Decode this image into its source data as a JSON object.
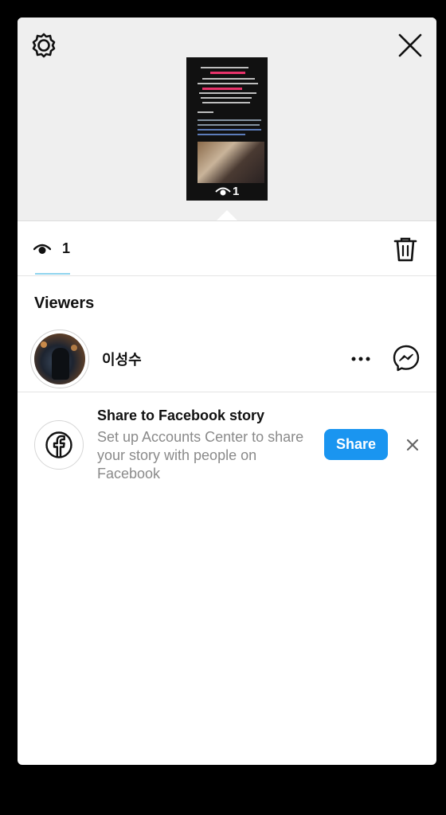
{
  "story_preview": {
    "view_count": "1"
  },
  "stats": {
    "view_count": "1"
  },
  "viewers": {
    "title": "Viewers",
    "list": [
      {
        "name": "이성수"
      }
    ]
  },
  "facebook_share": {
    "title": "Share to Facebook story",
    "description": "Set up Accounts Center to share your story with people on Facebook",
    "share_label": "Share"
  },
  "colors": {
    "accent_blue": "#1a95f0",
    "tab_underline": "#8fd4ee",
    "background": "#000000",
    "preview_bg": "#efefef"
  },
  "icons": [
    "settings-icon",
    "close-icon",
    "eye-icon",
    "trash-icon",
    "more-icon",
    "messenger-icon",
    "facebook-icon",
    "dismiss-icon"
  ]
}
